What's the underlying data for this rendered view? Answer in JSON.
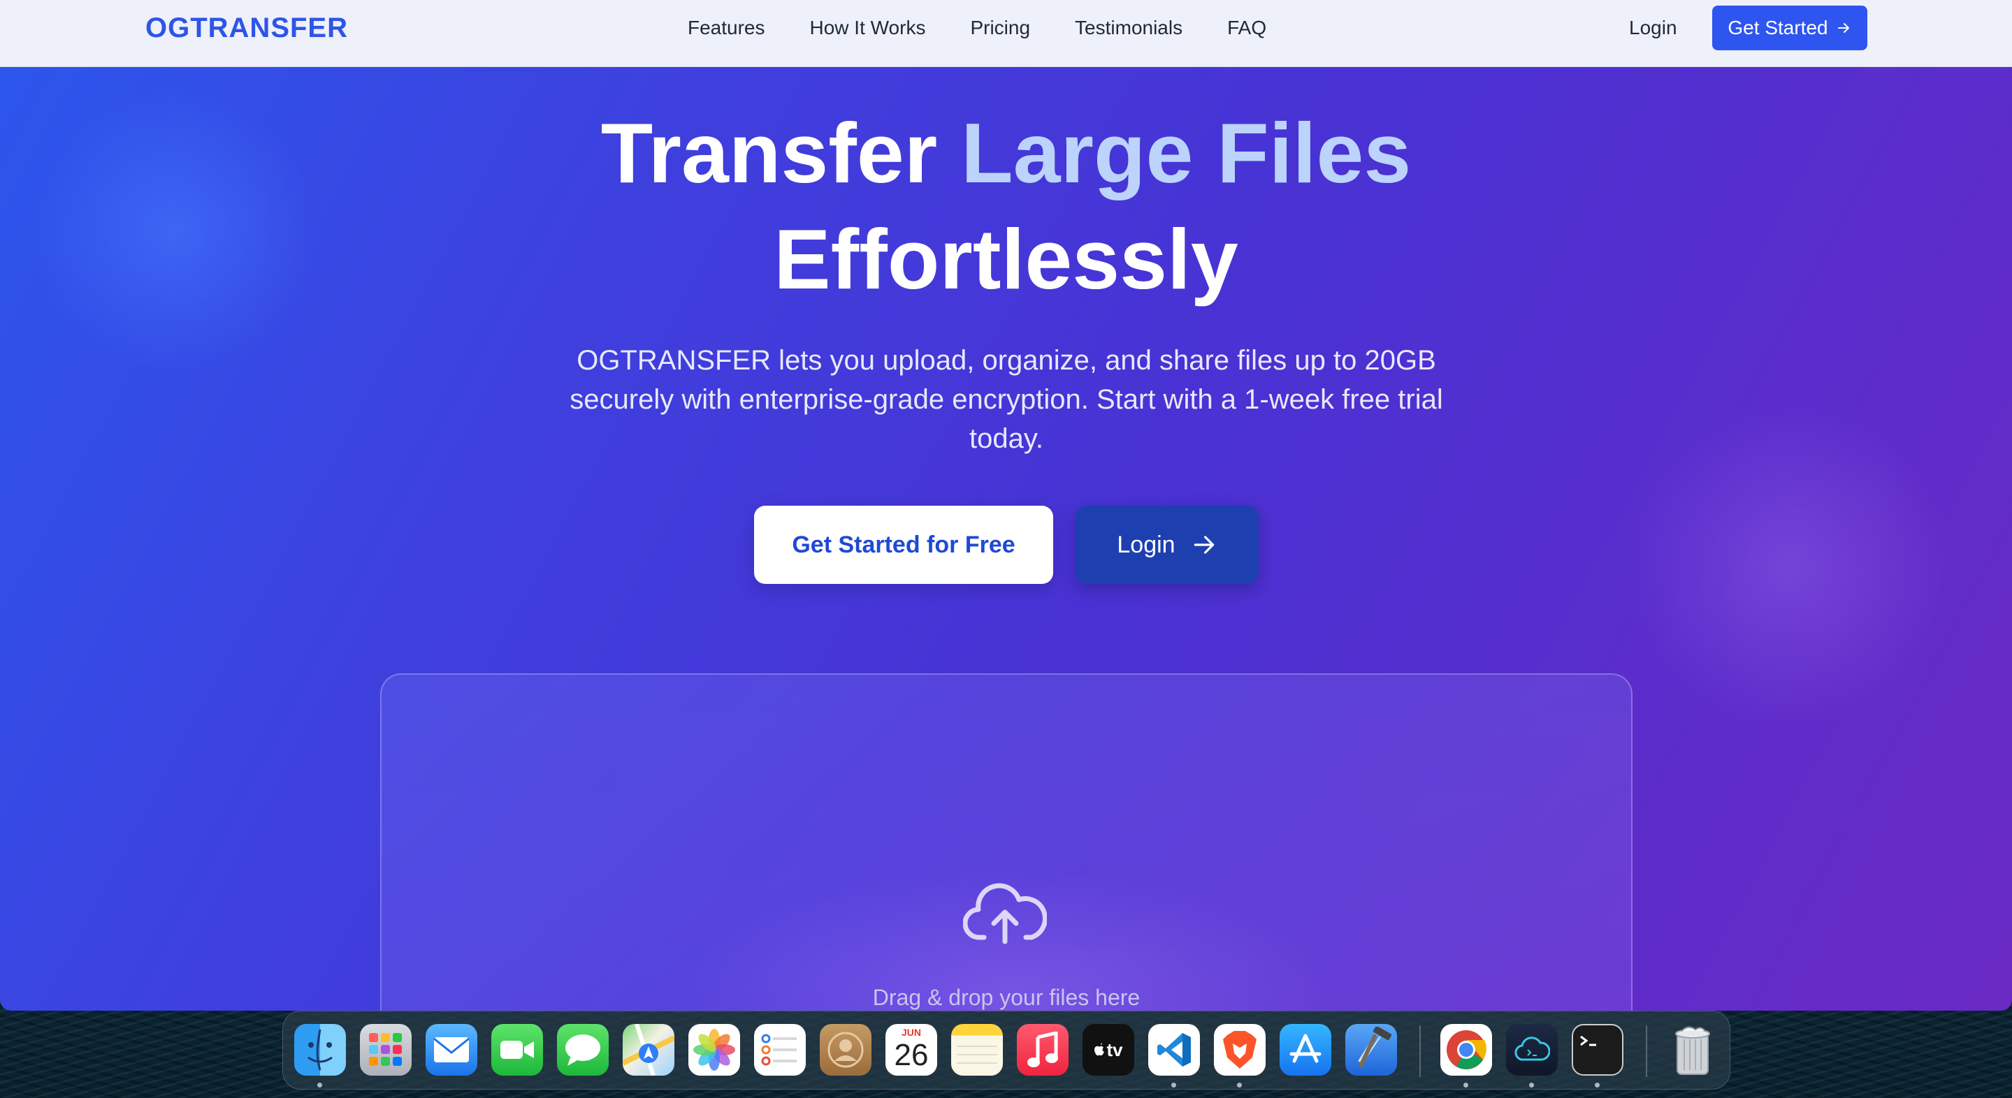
{
  "nav": {
    "logo": "OGTRANSFER",
    "links": [
      "Features",
      "How It Works",
      "Pricing",
      "Testimonials",
      "FAQ"
    ],
    "login": "Login",
    "cta": "Get Started"
  },
  "hero": {
    "title_white_1": "Transfer",
    "title_accent": "Large Files",
    "title_white_2": "Effortlessly",
    "subtitle": "OGTRANSFER lets you upload, organize, and share files up to 20GB securely with enterprise-grade encryption. Start with a 1-week free trial today.",
    "primary_button": "Get Started for Free",
    "secondary_button": "Login"
  },
  "dropzone": {
    "text": "Drag & drop your files here"
  },
  "dock": {
    "calendar_month": "JUN",
    "calendar_day": "26",
    "apps_tv_label": "tv",
    "items": [
      "finder-icon",
      "launchpad-icon",
      "mail-icon",
      "facetime-icon",
      "messages-icon",
      "maps-icon",
      "photos-icon",
      "reminders-icon",
      "contacts-icon",
      "calendar-icon",
      "notes-icon",
      "music-icon",
      "apple-tv-icon",
      "vscode-icon",
      "brave-icon",
      "app-store-icon",
      "xcode-icon",
      "chrome-icon",
      "cloud-terminal-icon",
      "terminal-icon",
      "trash-icon"
    ]
  },
  "colors": {
    "brand_blue": "#2e55e6",
    "accent_text": "#bcd3fb",
    "cta_blue": "#2e55f0",
    "secondary_button": "#1e3fb0"
  }
}
